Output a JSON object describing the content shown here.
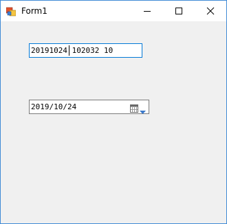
{
  "window": {
    "title": "Form1"
  },
  "icons": {
    "app": "form-app-icon",
    "minimize": "minimize-icon",
    "maximize": "maximize-icon",
    "close": "close-icon",
    "calendar": "calendar-icon",
    "dropdown": "chevron-down-icon"
  },
  "textbox": {
    "value": "20191024 102032 10"
  },
  "datepicker": {
    "value": "2019/10/24"
  },
  "colors": {
    "focus_border": "#0078d7",
    "window_border": "#3f8ad6",
    "form_background": "#f0f0f0"
  }
}
